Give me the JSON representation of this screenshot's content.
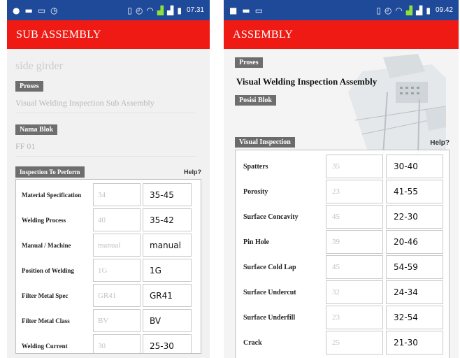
{
  "left": {
    "status_time": "07.31",
    "app_title": "SUB ASSEMBLY",
    "part_hint": "side girder",
    "proses_label": "Proses",
    "proses_value": "Visual Welding Inspection Sub Assembly",
    "nama_blok_label": "Nama Blok",
    "nama_blok_value": "FF 01",
    "inspection_header": "Inspection To Perform",
    "help": "Help?",
    "rows": [
      {
        "label": "Material Specification",
        "hint": "34",
        "value": "35-45"
      },
      {
        "label": "Welding Process",
        "hint": "40",
        "value": "35-42"
      },
      {
        "label": "Manual / Machine",
        "hint": "manual",
        "value": "manual"
      },
      {
        "label": "Position of Welding",
        "hint": "1G",
        "value": "1G"
      },
      {
        "label": "Filter Metal Spec",
        "hint": "GR41",
        "value": "GR41"
      },
      {
        "label": "Filter Metal Class",
        "hint": "BV",
        "value": "BV"
      },
      {
        "label": "Welding Current",
        "hint": "30",
        "value": "25-30"
      }
    ]
  },
  "right": {
    "status_time": "09.42",
    "app_title": "ASSEMBLY",
    "proses_label": "Proses",
    "proses_value": "Visual Welding Inspection Assembly",
    "posisi_blok_label": "Posisi Blok",
    "inspection_header": "Visual Inspection",
    "help": "Help?",
    "rows": [
      {
        "label": "Spatters",
        "hint": "35",
        "value": "30-40"
      },
      {
        "label": "Porosity",
        "hint": "23",
        "value": "41-55"
      },
      {
        "label": "Surface Concavity",
        "hint": "45",
        "value": "22-30"
      },
      {
        "label": "Pin Hole",
        "hint": "39",
        "value": "20-46"
      },
      {
        "label": "Surface Cold Lap",
        "hint": "45",
        "value": "54-59"
      },
      {
        "label": "Surface Undercut",
        "hint": "32",
        "value": "24-34"
      },
      {
        "label": "Surface Underfill",
        "hint": "23",
        "value": "32-54"
      },
      {
        "label": "Crack",
        "hint": "25",
        "value": "21-30"
      }
    ]
  },
  "colors": {
    "status_bar": "#1e4a99",
    "app_bar": "#f01a14",
    "tag": "#6e6e6e",
    "signal_green": "#8ee03c"
  }
}
